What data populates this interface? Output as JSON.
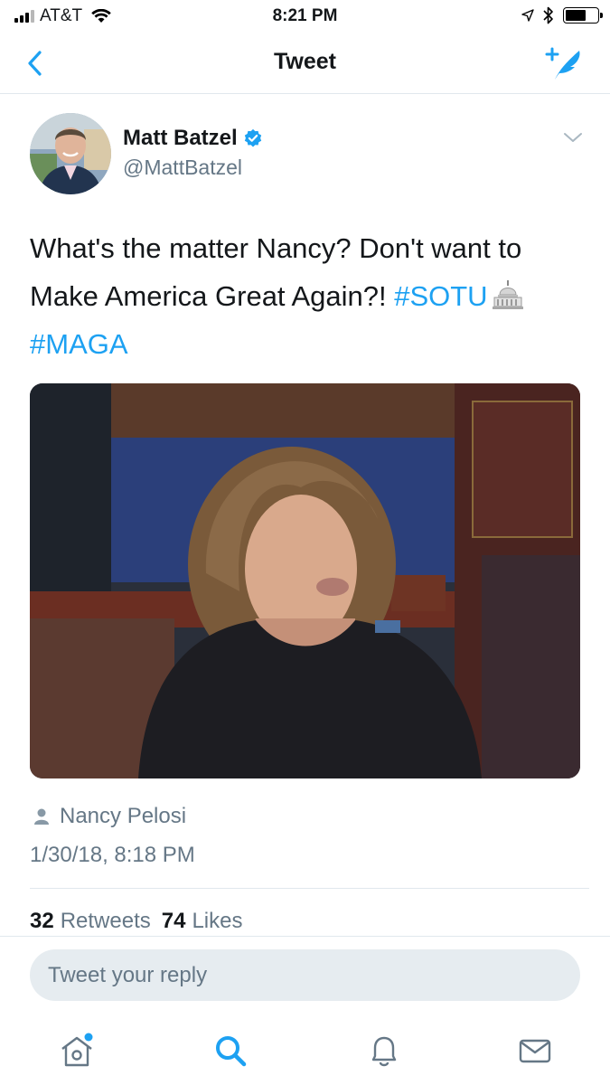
{
  "status_bar": {
    "carrier": "AT&T",
    "time": "8:21 PM",
    "battery_level": 0.65
  },
  "nav": {
    "title": "Tweet"
  },
  "tweet": {
    "author_name": "Matt Batzel",
    "author_handle": "@MattBatzel",
    "text_plain": "What's the matter Nancy? Don't want to Make America Great Again?! ",
    "hashtag_1": "#SOTU",
    "hashtag_2": "#MAGA",
    "tagged_person": "Nancy Pelosi",
    "timestamp": "1/30/18, 8:18 PM",
    "retweets_count": "32",
    "retweets_label": "Retweets",
    "likes_count": "74",
    "likes_label": "Likes"
  },
  "reply": {
    "placeholder": "Tweet your reply"
  },
  "colors": {
    "accent": "#1da1f2",
    "text": "#14171a",
    "secondary": "#657786"
  },
  "icons": {
    "back": "chevron-left-icon",
    "compose": "compose-tweet-icon",
    "verified": "verified-badge-icon",
    "caret": "chevron-down-icon",
    "capitol": "capitol-emoji-icon",
    "tagged": "person-icon",
    "tabs": [
      "home-icon",
      "search-icon",
      "notifications-icon",
      "messages-icon"
    ]
  }
}
